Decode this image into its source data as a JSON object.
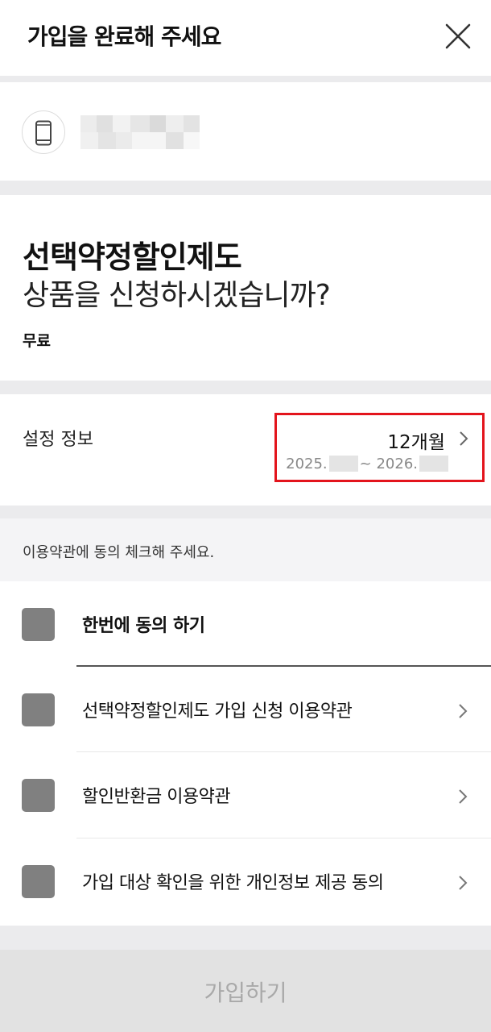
{
  "header": {
    "title": "가입을 완료해 주세요",
    "close_icon": "close-icon"
  },
  "device": {
    "icon": "smartphone-icon"
  },
  "product": {
    "name": "선택약정할인제도",
    "question": "상품을 신청하시겠습니까?",
    "price": "무료"
  },
  "settings": {
    "label": "설정 정보",
    "period": "12개월",
    "date_start": "2025.",
    "date_sep": "~ 2026.",
    "chevron_icon": "chevron-right-icon",
    "highlight_color": "#e3141c"
  },
  "terms": {
    "instruction": "이용약관에 동의 체크해 주세요.",
    "agree_all": "한번에 동의 하기",
    "items": [
      {
        "label": "선택약정할인제도 가입 신청 이용약관"
      },
      {
        "label": "할인반환금 이용약관"
      },
      {
        "label": "가입 대상 확인을 위한 개인정보 제공 동의"
      }
    ]
  },
  "footer": {
    "submit_label": "가입하기"
  }
}
